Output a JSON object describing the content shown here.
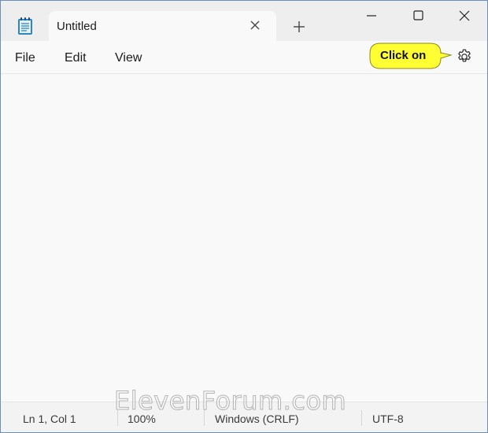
{
  "tab": {
    "title": "Untitled"
  },
  "menu": {
    "file": "File",
    "edit": "Edit",
    "view": "View"
  },
  "callout": {
    "text": "Click on"
  },
  "status": {
    "position": "Ln 1, Col 1",
    "zoom": "100%",
    "line_ending": "Windows (CRLF)",
    "encoding": "UTF-8"
  },
  "watermark": "ElevenForum.com",
  "colors": {
    "callout_fill": "#ffff33",
    "window_border": "#6c8fb8"
  },
  "icons": [
    "notepad-app-icon",
    "close-icon",
    "plus-icon",
    "minimize-icon",
    "maximize-icon",
    "close-window-icon",
    "gear-icon"
  ]
}
